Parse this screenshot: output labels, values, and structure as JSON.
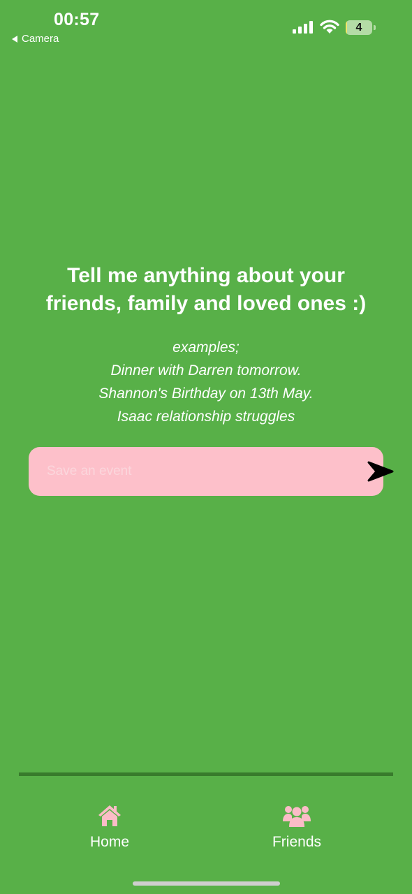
{
  "status_bar": {
    "time": "00:57",
    "back_label": "Camera",
    "battery_level": "4",
    "battery_fraction": 0.04
  },
  "main": {
    "headline_lines": [
      "Tell me anything about your",
      "friends, family and loved ones :)"
    ],
    "examples": [
      "examples;",
      "Dinner with Darren tomorrow.",
      "Shannon's Birthday on 13th May.",
      "Isaac relationship struggles"
    ],
    "input": {
      "placeholder": "Save an event",
      "value": ""
    }
  },
  "tab_bar": {
    "items": [
      {
        "label": "Home",
        "icon": "home-icon"
      },
      {
        "label": "Friends",
        "icon": "friends-icon"
      }
    ]
  },
  "colors": {
    "background": "#58b048",
    "input_background": "#fdc0ca",
    "icon_pink": "#fbbcc7",
    "divider": "#387b2c",
    "text": "#ffffff"
  }
}
